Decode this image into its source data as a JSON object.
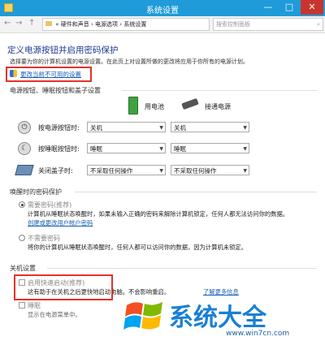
{
  "window": {
    "title": "系统设置",
    "minimize": "—",
    "maximize": "□",
    "close": "✕"
  },
  "nav": {
    "back": "←",
    "forward": "→",
    "up": "↑"
  },
  "address": {
    "root": "«",
    "crumbs": [
      "硬件和声音",
      "电源选项",
      "系统设置"
    ],
    "sep": "›"
  },
  "search": {
    "placeholder": "搜索控制面板"
  },
  "main": {
    "title": "定义电源按钮并启用密码保护",
    "subtitle": "选择要为你的计算机设置的电源设置。在此页上对设置所做的更改将应用于你所有的电源计划。",
    "change_link": "更改当前不可用的设置"
  },
  "power_section": {
    "title": "电源按钮、睡眠按钮和盖子设置",
    "col_battery": "用电池",
    "col_plugged": "接通电源",
    "rows": [
      {
        "label": "按电源按钮时:",
        "battery": "关机",
        "plugged": "关机"
      },
      {
        "label": "按睡眠按钮时:",
        "battery": "睡眠",
        "plugged": "睡眠"
      },
      {
        "label": "关闭盖子时:",
        "battery": "不采取任何操作",
        "plugged": "不采取任何操作"
      }
    ]
  },
  "password_section": {
    "title": "唤醒时的密码保护",
    "opt1_label": "需要密码(推荐)",
    "opt1_desc": "计算机从睡眠状态唤醒时，如果未输入正确的密码来解除计算机锁定，任何人都无法访问你的数据。",
    "opt1_link": "创建或更改用户帐户密码",
    "opt2_label": "不需要密码",
    "opt2_desc": "将你的计算机从睡眠状态唤醒时，任何人都可以访问你的数据，因为计算机未锁定。"
  },
  "shutdown_section": {
    "title": "关机设置",
    "fast_label": "启用快速启动(推荐)",
    "fast_desc": "这有助于在关机之后更快地启动电脑。不会影响重启。",
    "fast_link": "了解更多信息",
    "sleep_label": "睡眠",
    "sleep_desc": "显示在电源菜单中。"
  },
  "watermark": {
    "text": "系统大全",
    "url": "www.win7cn.com"
  },
  "colors": {
    "titlebar": "#1e9bd8",
    "heading": "#1f3a93",
    "link": "#1a5fb4",
    "highlight": "#e4312b"
  }
}
